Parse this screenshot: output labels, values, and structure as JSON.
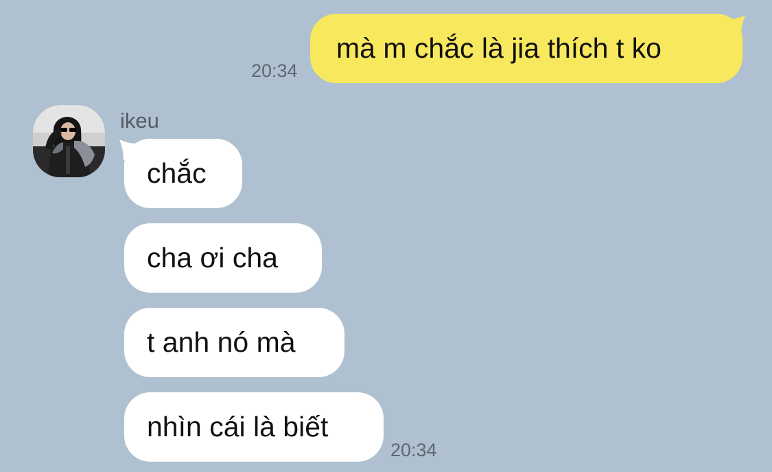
{
  "chat": {
    "outgoing": [
      {
        "text": "mà m chắc là jia thích t ko",
        "time": "20:34"
      }
    ],
    "incoming_group": {
      "sender": {
        "name": "ikeu",
        "avatar_icon": "profile-photo-icon"
      },
      "messages": [
        {
          "text": "chắc"
        },
        {
          "text": "cha ơi cha"
        },
        {
          "text": "t anh nó mà"
        },
        {
          "text": "nhìn cái là biết"
        }
      ],
      "time": "20:34"
    }
  },
  "colors": {
    "background": "#afc1d0",
    "outgoing_bubble": "#f8e85e",
    "incoming_bubble": "#ffffff",
    "timestamp": "#5c6770",
    "sender_name": "#535c63"
  }
}
